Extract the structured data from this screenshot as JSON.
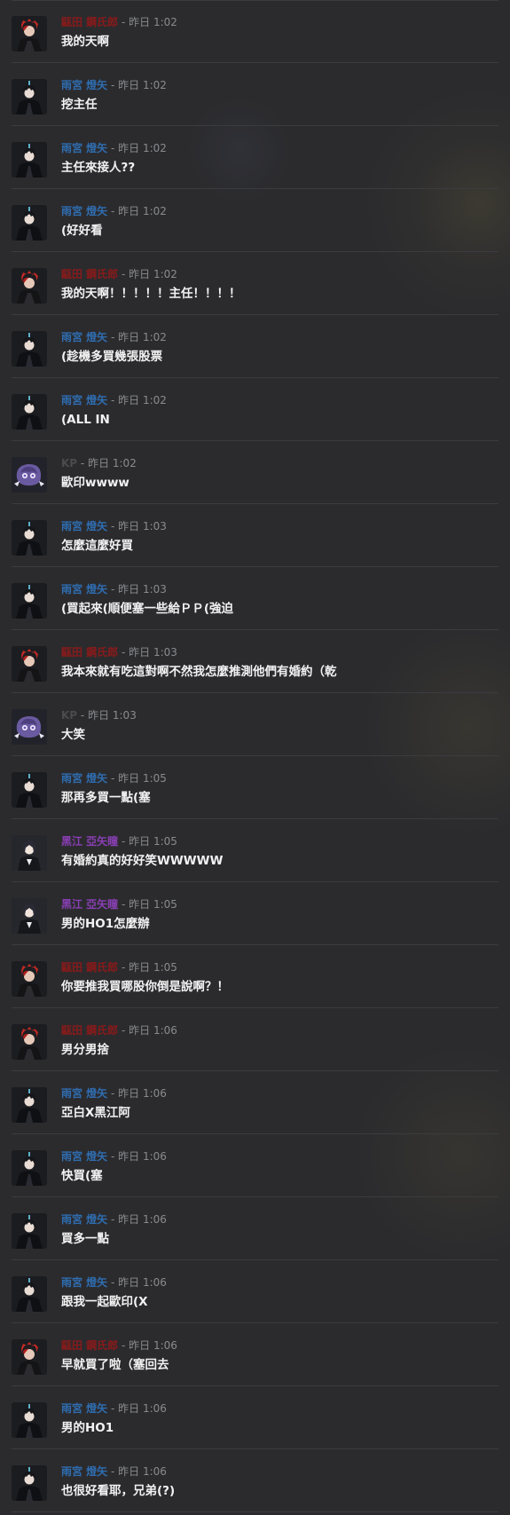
{
  "colors": {
    "background": "#2b2b2e",
    "red_name": "#8a1a1a",
    "blue_name": "#2f6db0",
    "purple_name": "#8a3fb5",
    "gray_name": "#4b4b4f",
    "timestamp": "#8a8b8f",
    "message_text": "#f2f2f2"
  },
  "messages": [
    {
      "speaker": "甌田 鋼氏郎",
      "color": "red",
      "avatar": "red-hair-avatar",
      "time": "昨日 1:02",
      "text": "我的天啊"
    },
    {
      "speaker": "雨宮 燈矢",
      "color": "blue",
      "avatar": "dark-hair-avatar",
      "time": "昨日 1:02",
      "text": "挖主任"
    },
    {
      "speaker": "雨宮 燈矢",
      "color": "blue",
      "avatar": "dark-hair-avatar",
      "time": "昨日 1:02",
      "text": "主任來接人??"
    },
    {
      "speaker": "雨宮 燈矢",
      "color": "blue",
      "avatar": "dark-hair-avatar",
      "time": "昨日 1:02",
      "text": "(好好看"
    },
    {
      "speaker": "甌田 鋼氏郎",
      "color": "red",
      "avatar": "red-hair-avatar",
      "time": "昨日 1:02",
      "text": "我的天啊！！！！！主任！！！！"
    },
    {
      "speaker": "雨宮 燈矢",
      "color": "blue",
      "avatar": "dark-hair-avatar",
      "time": "昨日 1:02",
      "text": "(趁機多買幾張股票"
    },
    {
      "speaker": "雨宮 燈矢",
      "color": "blue",
      "avatar": "dark-hair-avatar",
      "time": "昨日 1:02",
      "text": "(ALL IN"
    },
    {
      "speaker": "KP",
      "color": "gray",
      "avatar": "kp-avatar",
      "time": "昨日 1:02",
      "text": "歐印wwww"
    },
    {
      "speaker": "雨宮 燈矢",
      "color": "blue",
      "avatar": "dark-hair-avatar",
      "time": "昨日 1:03",
      "text": "怎麼這麼好買"
    },
    {
      "speaker": "雨宮 燈矢",
      "color": "blue",
      "avatar": "dark-hair-avatar",
      "time": "昨日 1:03",
      "text": "(買起來(順便塞一些給ＰＰ(強迫"
    },
    {
      "speaker": "甌田 鋼氏郎",
      "color": "red",
      "avatar": "red-hair-avatar",
      "time": "昨日 1:03",
      "text": "我本來就有吃這對啊不然我怎麼推測他們有婚約（乾"
    },
    {
      "speaker": "KP",
      "color": "gray",
      "avatar": "kp-avatar",
      "time": "昨日 1:03",
      "text": "大笑"
    },
    {
      "speaker": "雨宮 燈矢",
      "color": "blue",
      "avatar": "dark-hair-avatar",
      "time": "昨日 1:05",
      "text": "那再多買一點(塞"
    },
    {
      "speaker": "黑江 亞矢瞳",
      "color": "purple",
      "avatar": "suit-avatar",
      "time": "昨日 1:05",
      "text": "有婚約真的好好笑WWWWW"
    },
    {
      "speaker": "黑江 亞矢瞳",
      "color": "purple",
      "avatar": "suit-avatar",
      "time": "昨日 1:05",
      "text": "男的HO1怎麼辦"
    },
    {
      "speaker": "甌田 鋼氏郎",
      "color": "red",
      "avatar": "red-hair-avatar",
      "time": "昨日 1:05",
      "text": "你要推我買哪股你倒是說啊？！"
    },
    {
      "speaker": "甌田 鋼氏郎",
      "color": "red",
      "avatar": "red-hair-avatar",
      "time": "昨日 1:06",
      "text": "男分男捨"
    },
    {
      "speaker": "雨宮 燈矢",
      "color": "blue",
      "avatar": "dark-hair-avatar",
      "time": "昨日 1:06",
      "text": "亞白X黑江阿"
    },
    {
      "speaker": "雨宮 燈矢",
      "color": "blue",
      "avatar": "dark-hair-avatar",
      "time": "昨日 1:06",
      "text": "快買(塞"
    },
    {
      "speaker": "雨宮 燈矢",
      "color": "blue",
      "avatar": "dark-hair-avatar",
      "time": "昨日 1:06",
      "text": "買多一點"
    },
    {
      "speaker": "雨宮 燈矢",
      "color": "blue",
      "avatar": "dark-hair-avatar",
      "time": "昨日 1:06",
      "text": "跟我一起歐印(X"
    },
    {
      "speaker": "甌田 鋼氏郎",
      "color": "red",
      "avatar": "red-hair-avatar",
      "time": "昨日 1:06",
      "text": "早就買了啦（塞回去"
    },
    {
      "speaker": "雨宮 燈矢",
      "color": "blue",
      "avatar": "dark-hair-avatar",
      "time": "昨日 1:06",
      "text": "男的HO1"
    },
    {
      "speaker": "雨宮 燈矢",
      "color": "blue",
      "avatar": "dark-hair-avatar",
      "time": "昨日 1:06",
      "text": "也很好看耶，兄弟(?)"
    }
  ]
}
